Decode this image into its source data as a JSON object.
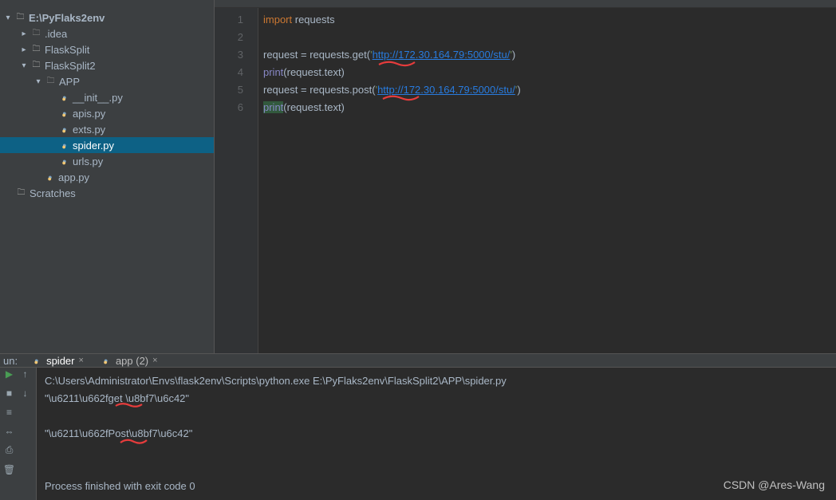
{
  "tree": {
    "root": "E:\\PyFlaks2env",
    "nodes": [
      {
        "name": ".idea",
        "depth": 1,
        "kind": "folder-dark",
        "expandable": true,
        "open": false
      },
      {
        "name": "FlaskSplit",
        "depth": 1,
        "kind": "folder",
        "expandable": true,
        "open": false
      },
      {
        "name": "FlaskSplit2",
        "depth": 1,
        "kind": "folder",
        "expandable": true,
        "open": true
      },
      {
        "name": "APP",
        "depth": 2,
        "kind": "folder-dark",
        "expandable": true,
        "open": true
      },
      {
        "name": "__init__.py",
        "depth": 3,
        "kind": "py"
      },
      {
        "name": "apis.py",
        "depth": 3,
        "kind": "py"
      },
      {
        "name": "exts.py",
        "depth": 3,
        "kind": "py"
      },
      {
        "name": "spider.py",
        "depth": 3,
        "kind": "py",
        "selected": true
      },
      {
        "name": "urls.py",
        "depth": 3,
        "kind": "py"
      },
      {
        "name": "app.py",
        "depth": 2,
        "kind": "py"
      },
      {
        "name": "Scratches",
        "depth": 0,
        "kind": "folder-grey"
      }
    ]
  },
  "code": {
    "lines": [
      {
        "n": 1,
        "tokens": [
          {
            "t": "import",
            "c": "kw"
          },
          {
            "t": " requests",
            "c": "ident"
          }
        ]
      },
      {
        "n": 2,
        "tokens": []
      },
      {
        "n": 3,
        "tokens": [
          {
            "t": "request ",
            "c": "ident"
          },
          {
            "t": "=",
            "c": "ident"
          },
          {
            "t": " requests.",
            "c": "ident"
          },
          {
            "t": "get",
            "c": "call"
          },
          {
            "t": "(",
            "c": "ident"
          },
          {
            "t": "'",
            "c": "str"
          },
          {
            "t": "http://172.30.164.79:5000/stu/",
            "c": "url"
          },
          {
            "t": "'",
            "c": "str"
          },
          {
            "t": ")",
            "c": "ident"
          }
        ]
      },
      {
        "n": 4,
        "tokens": [
          {
            "t": "print",
            "c": "bi"
          },
          {
            "t": "(request.text)",
            "c": "ident"
          }
        ]
      },
      {
        "n": 5,
        "tokens": [
          {
            "t": "request ",
            "c": "ident"
          },
          {
            "t": "=",
            "c": "ident"
          },
          {
            "t": " requests.",
            "c": "ident"
          },
          {
            "t": "post",
            "c": "call"
          },
          {
            "t": "(",
            "c": "ident"
          },
          {
            "t": "'",
            "c": "str"
          },
          {
            "t": "http://172.30.164.79:5000/stu/",
            "c": "url"
          },
          {
            "t": "'",
            "c": "str"
          },
          {
            "t": ")",
            "c": "ident"
          }
        ]
      },
      {
        "n": 6,
        "tokens": [
          {
            "t": "print",
            "c": "bi hl"
          },
          {
            "t": "(request.text)",
            "c": "ident"
          }
        ]
      }
    ]
  },
  "run": {
    "label": "un:",
    "tabs": [
      {
        "name": "spider",
        "active": true
      },
      {
        "name": "app (2)",
        "active": false
      }
    ],
    "output": [
      "C:\\Users\\Administrator\\Envs\\flask2env\\Scripts\\python.exe E:\\PyFlaks2env\\FlaskSplit2\\APP\\spider.py",
      "\"\\u6211\\u662fget \\u8bf7\\u6c42\"",
      "",
      "\"\\u6211\\u662fPost\\u8bf7\\u6c42\"",
      "",
      "",
      "Process finished with exit code 0"
    ]
  },
  "watermark": "CSDN @Ares-Wang"
}
